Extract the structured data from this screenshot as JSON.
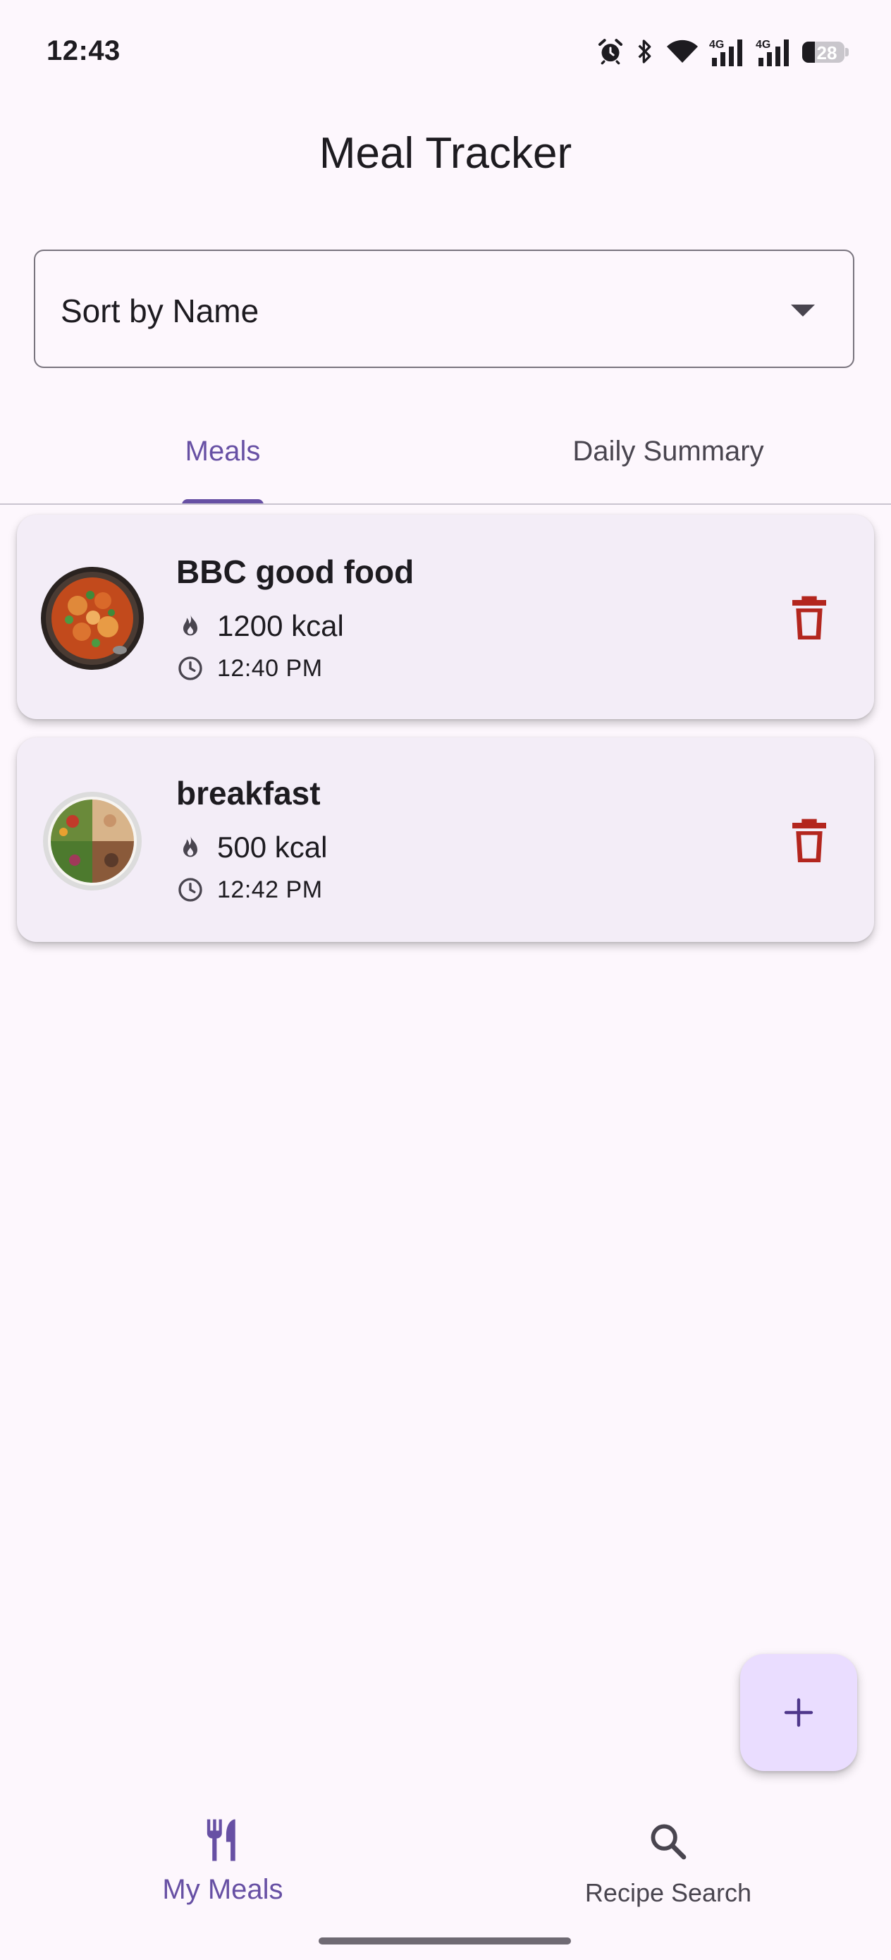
{
  "status_bar": {
    "time": "12:43",
    "battery_level": "28",
    "icons": [
      "alarm-icon",
      "bluetooth-icon",
      "wifi-icon",
      "signal-4g-icon",
      "signal-4g-icon",
      "battery-icon"
    ]
  },
  "header": {
    "title": "Meal Tracker"
  },
  "sort": {
    "selected": "Sort by Name"
  },
  "tabs": [
    {
      "label": "Meals",
      "active": true
    },
    {
      "label": "Daily Summary",
      "active": false
    }
  ],
  "meals": [
    {
      "name": "BBC good food",
      "calories": "1200 kcal",
      "time": "12:40 PM",
      "image": "pan-dish-photo"
    },
    {
      "name": "breakfast",
      "calories": "500 kcal",
      "time": "12:42 PM",
      "image": "salad-plate-photo"
    }
  ],
  "fab": {
    "icon": "plus-icon"
  },
  "bottom_nav": [
    {
      "label": "My Meals",
      "icon": "utensils-icon",
      "active": true
    },
    {
      "label": "Recipe Search",
      "icon": "search-icon",
      "active": false
    }
  ],
  "colors": {
    "primary": "#6750a4",
    "background": "#fdf7fd",
    "card": "#f3edf7",
    "delete": "#b3261e",
    "fab": "#eaddff"
  }
}
